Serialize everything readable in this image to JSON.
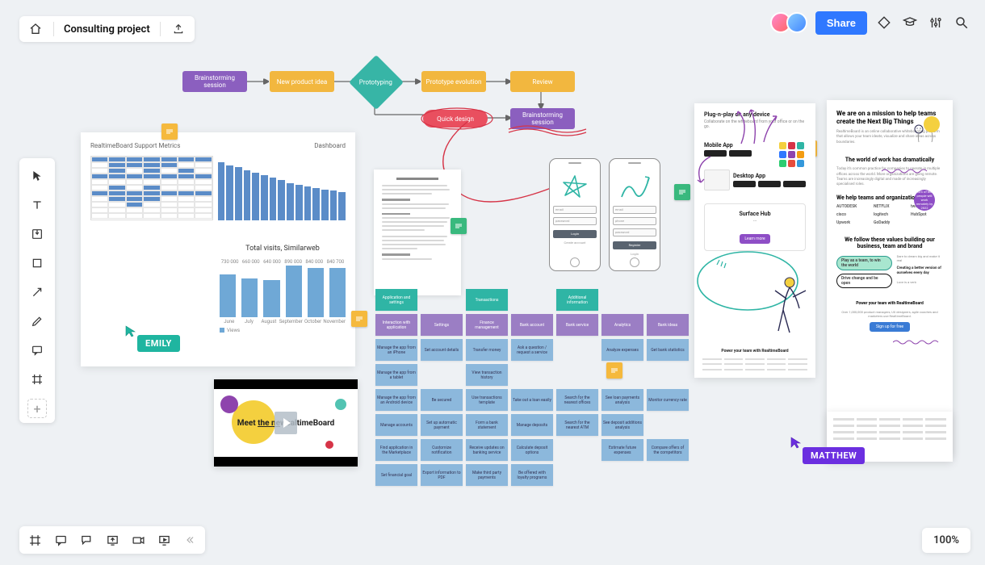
{
  "header": {
    "title": "Consulting project",
    "share_label": "Share"
  },
  "zoom": "100%",
  "cursors": {
    "emily": "EMILY",
    "matthew": "MATTHEW"
  },
  "flow": {
    "n1": "Brainstorming session",
    "n2": "New product idea",
    "n3": "Prototyping",
    "n4": "Prototype evolution",
    "n5": "Review",
    "n6": "Quick design",
    "n7": "Brainstorming session"
  },
  "dashboard": {
    "title": "RealtimeBoard Support Metrics",
    "tab": "Dashboard"
  },
  "chart_data": {
    "type": "bar",
    "title": "Total visits, Similarweb",
    "categories": [
      "June",
      "July",
      "August",
      "September",
      "October",
      "November"
    ],
    "values": [
      730000,
      660000,
      640000,
      890000,
      840000,
      840700
    ],
    "labels": [
      "730 000",
      "660 000",
      "640 000",
      "890 000",
      "840 000",
      "840 700"
    ],
    "legend": "Views",
    "ylim": [
      0,
      900000
    ]
  },
  "video": {
    "text_pre": "Meet ",
    "text_u": "the ne",
    "text_post": "wcaltimeBoard"
  },
  "wire": {
    "p1_field1": "email",
    "p1_field2": "password",
    "p1_btn": "Login",
    "p1_link": "Create account",
    "p2_field1": "email",
    "p2_field2": "phone",
    "p2_field3": "password",
    "p2_btn": "Register",
    "p2_link": "Login"
  },
  "stickies": [
    [
      "Application and settings",
      "",
      "Transactions",
      "",
      "Additional information",
      ""
    ],
    [
      "Interaction with application",
      "Settings",
      "Finance management",
      "Bank account",
      "Bank service",
      "Analytics",
      "Bank ideas"
    ],
    [
      "Manage the app from an iPhone",
      "Set account details",
      "Transfer money",
      "Ask a question / request a service",
      "",
      "Analyze expenses",
      "Get bank statistics"
    ],
    [
      "Manage the app from a tablet",
      "",
      "View transaction history",
      "",
      "",
      "",
      ""
    ],
    [
      "Manage the app from an Android device",
      "Be secured",
      "Use transactions template",
      "Take out a loan easily",
      "Search for the nearest offices",
      "See loan payments analysis",
      "Monitor currency rate"
    ],
    [
      "Manage accounts",
      "Set up automatic payment",
      "Form a bank statement",
      "Manage deposits",
      "Search for the nearest ATM",
      "See deposit additions analysis",
      ""
    ],
    [
      "Find application in the Marketplace",
      "Customize notification",
      "Receive updates on banking service",
      "Calculate deposit options",
      "",
      "Estimate future expenses",
      "Compare offers of the competitors"
    ],
    [
      "Set financial goal",
      "Export information to PDF",
      "Make third party payments",
      "Be offered with loyalty programs",
      "",
      "",
      ""
    ]
  ],
  "stickyRowTypes": [
    "te",
    "pu",
    "bl",
    "bl",
    "bl",
    "bl",
    "bl",
    "bl"
  ],
  "mock1": {
    "h1": "Plug-n-play on any device",
    "p1": "Collaborate on the whiteboard from your office or on the go.",
    "mobile_h": "Mobile App",
    "desktop_h": "Desktop App",
    "hub_h": "Surface Hub",
    "hub_btn": "Learn more",
    "foot_h": "Power your team with RealtimeBoard"
  },
  "mock2": {
    "h1": "We are on a mission to help teams create the Next Big Things",
    "p1": "RealtimeBoard is an online collaborative whiteboarding platform that allows your team ideate, visualize and share ideas across boundaries.",
    "h2": "The world of work has dramatically",
    "p2": "Today it's common practice for companies to operate in multiple offices across the world. More organizations are going remote. Teams are increasingly digital and made of increasingly specialised roles.",
    "h3": "We help teams and organizations",
    "circ": "60% of the people will work remotely by 2022",
    "logos": [
      "AUTODESK",
      "NETFLIX",
      "twitter",
      "cisco",
      "logitech",
      "HubSpot",
      "Upwork",
      "GoDaddy",
      ""
    ],
    "h4": "We follow these values building our business, team and brand",
    "pill1": "Play as a team, to win the world",
    "pill2": "Drive change and be open",
    "sub1": "Dare to dream big and make it real",
    "sub2": "Creating a better version of ourselves every day",
    "sub3": "Love is a verb",
    "foot_h": "Power your team with RealtimeBoard",
    "foot_p": "Over 1,000,000 product managers, UX designers, agile coaches and marketers use RealtimeBoard.",
    "cta": "Sign up for free"
  }
}
